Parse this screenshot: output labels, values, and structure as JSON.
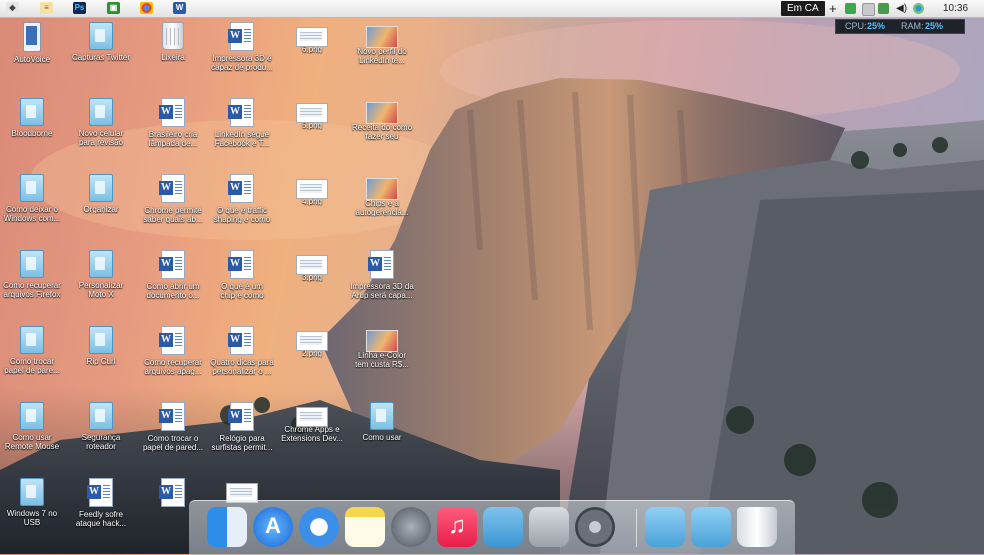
{
  "taskbar": {
    "apps": [
      {
        "name": "word-app-icon"
      },
      {
        "name": "notepad-app-icon"
      },
      {
        "name": "photoshop-app-icon",
        "label": "Ps"
      },
      {
        "name": "greenshot-app-icon"
      },
      {
        "name": "chrome-app-icon"
      },
      {
        "name": "word-document-app-icon"
      }
    ],
    "language_indicator": "Em CA",
    "add_symbol": "+",
    "clock": "10:36"
  },
  "performance_widget": {
    "cpu_label": "CPU:",
    "cpu_value": "25%",
    "ram_label": "RAM:",
    "ram_value": "25%"
  },
  "desktop": {
    "icons": [
      {
        "label": "AutoVoice",
        "kind": "phone"
      },
      {
        "label": "Capturas Twitter",
        "kind": "folder"
      },
      {
        "label": "Lixeira",
        "kind": "bin"
      },
      {
        "label": "Impressora 3D é\ncapaz de produ...",
        "kind": "word"
      },
      {
        "label": "6.png",
        "kind": "png"
      },
      {
        "label": "Novo perfil do\nLinkedIn te...",
        "kind": "thumb"
      },
      {
        "label": "Bloodborne",
        "kind": "folder"
      },
      {
        "label": "Novo celular\npara revisão",
        "kind": "folder"
      },
      {
        "label": "Brasileiro cria\nlâmpada de...",
        "kind": "word"
      },
      {
        "label": "LinkedIn segue\nFacebook e T...",
        "kind": "word"
      },
      {
        "label": "5.png",
        "kind": "png"
      },
      {
        "label": "Receita do como\nfazer seu Chrom...",
        "kind": "thumb"
      },
      {
        "label": "Como deixar o\nWindows com...",
        "kind": "folder"
      },
      {
        "label": "Organizar",
        "kind": "folder"
      },
      {
        "label": "Chrome permite\nsaber quais ab...",
        "kind": "word"
      },
      {
        "label": "O que é traffic\nshaping e como",
        "kind": "word"
      },
      {
        "label": "4.png",
        "kind": "png"
      },
      {
        "label": "Chips e a\nautogerenciá...",
        "kind": "thumb"
      },
      {
        "label": "Como recuperar\narquivos Firefox",
        "kind": "folder"
      },
      {
        "label": "Personalizar\nMoto X",
        "kind": "folder"
      },
      {
        "label": "Como abrir um\ndocumento o...",
        "kind": "word"
      },
      {
        "label": "O que é um\nchip e como",
        "kind": "word"
      },
      {
        "label": "3.png",
        "kind": "png"
      },
      {
        "label": "Impressora 3D da\nArup será capa...",
        "kind": "word"
      },
      {
        "label": "Como trocar\npapel de pare...",
        "kind": "folder"
      },
      {
        "label": "Rip Curl",
        "kind": "folder"
      },
      {
        "label": "Como recuperar\narquivos apag...",
        "kind": "word"
      },
      {
        "label": "Quatro dicas para\npersonalizar o ...",
        "kind": "word"
      },
      {
        "label": "2.png",
        "kind": "png"
      },
      {
        "label": "Linha e-Color\ntem custa R$...",
        "kind": "thumb"
      },
      {
        "label": "Como usar\nRemote Mouse",
        "kind": "folder"
      },
      {
        "label": "Segurança\nroteador",
        "kind": "folder"
      },
      {
        "label": "Como trocar o\npapel de pared...",
        "kind": "word"
      },
      {
        "label": "Relógio para\nsurfistas permit...",
        "kind": "word"
      },
      {
        "label": "Chrome Apps e\nExtensions Dev...",
        "kind": "png"
      },
      {
        "label": "Como usar",
        "kind": "folder"
      },
      {
        "label": "Windows 7 no\nUSB",
        "kind": "folder"
      },
      {
        "label": "Feedly sofre\nataque hack...",
        "kind": "word"
      },
      {
        "label": "",
        "kind": "word"
      },
      {
        "label": "",
        "kind": "png"
      }
    ]
  },
  "dock": {
    "items": [
      {
        "name": "finder-icon"
      },
      {
        "name": "app-store-icon"
      },
      {
        "name": "safari-icon"
      },
      {
        "name": "notes-icon"
      },
      {
        "name": "launchpad-rocket-icon"
      },
      {
        "name": "itunes-icon"
      },
      {
        "name": "applications-folder-icon"
      },
      {
        "name": "apple-logo-icon"
      },
      {
        "name": "system-preferences-icon"
      },
      {
        "name": "downloads-folder-icon"
      },
      {
        "name": "documents-folder-icon"
      },
      {
        "name": "trash-icon"
      }
    ]
  }
}
